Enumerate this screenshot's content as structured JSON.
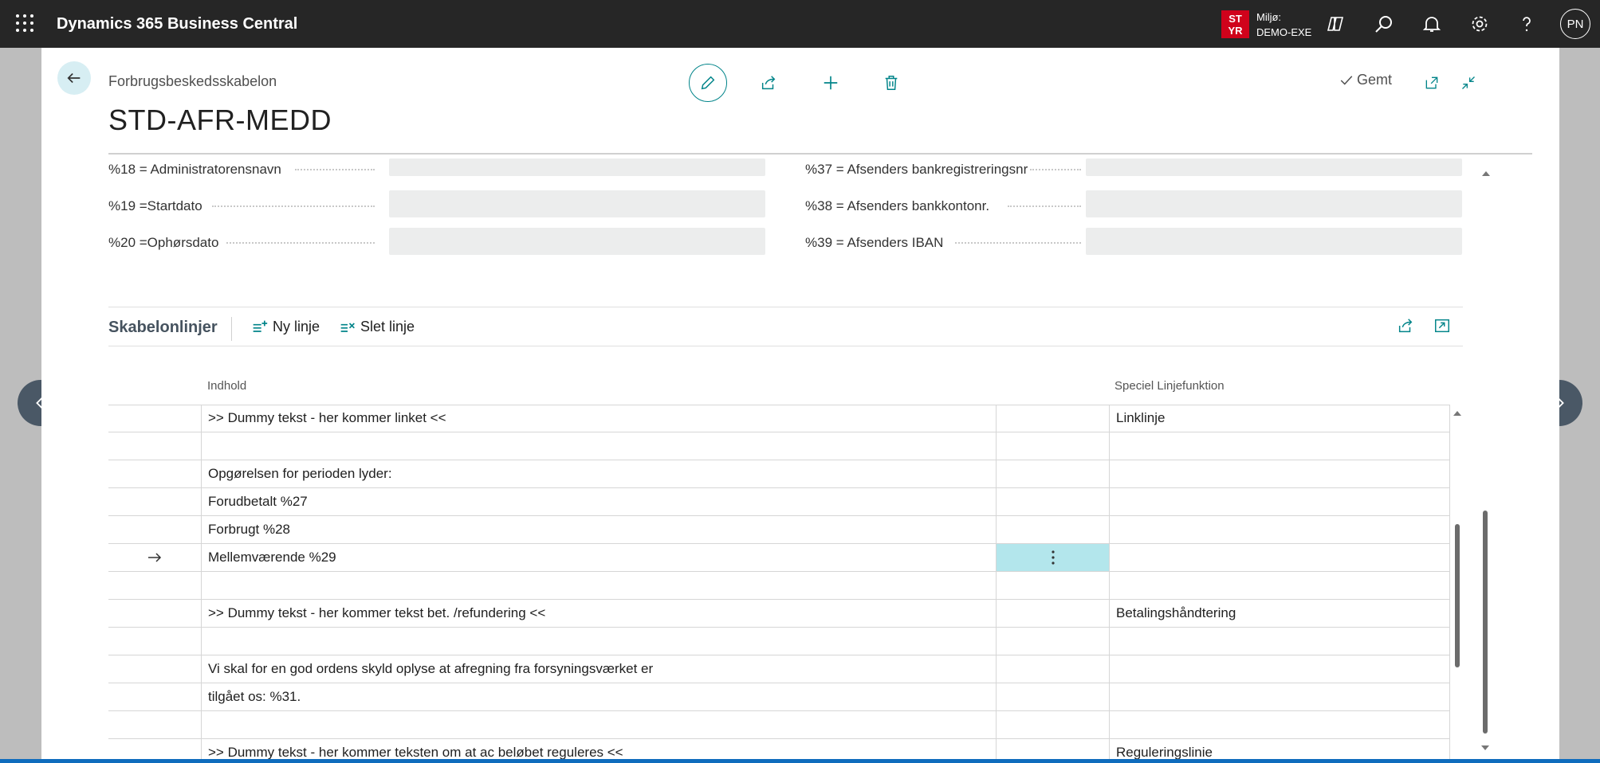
{
  "app": {
    "title": "Dynamics 365 Business Central",
    "environment_badge_line1": "ST",
    "environment_badge_line2": "YR",
    "environment_label": "Miljø:",
    "environment_name": "DEMO-EXE",
    "user_initials": "PN"
  },
  "header": {
    "caption": "Forbrugsbeskedsskabelon",
    "record_title": "STD-AFR-MEDD",
    "saved_label": "Gemt"
  },
  "fields_left": [
    {
      "label": "%18 = Administratorensnavn",
      "value": ""
    },
    {
      "label": "%19 =Startdato",
      "value": ""
    },
    {
      "label": "%20 =Ophørsdato",
      "value": ""
    }
  ],
  "fields_right": [
    {
      "label": "%37 = Afsenders bankregistreringsnr",
      "value": ""
    },
    {
      "label": "%38 = Afsenders bankkontonr.",
      "value": ""
    },
    {
      "label": "%39 = Afsenders IBAN",
      "value": ""
    }
  ],
  "part": {
    "title": "Skabelonlinjer",
    "new_line": "Ny linje",
    "delete_line": "Slet linje",
    "columns": {
      "content": "Indhold",
      "special": "Speciel Linjefunktion"
    },
    "rows": [
      {
        "content": ">> Dummy tekst - her kommer linket <<",
        "special": "Linklinje"
      },
      {
        "content": "",
        "special": ""
      },
      {
        "content": "Opgørelsen for perioden lyder:",
        "special": ""
      },
      {
        "content": "Forudbetalt %27",
        "special": ""
      },
      {
        "content": "Forbrugt %28",
        "special": ""
      },
      {
        "content": "Mellemværende %29",
        "special": "",
        "current": true
      },
      {
        "content": "",
        "special": ""
      },
      {
        "content": ">> Dummy tekst - her kommer tekst bet. /refundering <<",
        "special": "Betalingshåndtering"
      },
      {
        "content": "",
        "special": ""
      },
      {
        "content": "Vi skal for en god ordens skyld oplyse at afregning fra forsyningsværket er",
        "special": ""
      },
      {
        "content": "tilgået os: %31.",
        "special": ""
      },
      {
        "content": "",
        "special": ""
      },
      {
        "content": ">> Dummy tekst - her kommer teksten om at ac beløbet reguleres <<",
        "special": "Reguleringslinie"
      }
    ]
  },
  "icons": {
    "waffle": "app-launcher-icon",
    "copilot": "copilot-icon",
    "search": "search-icon",
    "bell": "notification-icon",
    "gear": "settings-icon",
    "help": "help-icon",
    "back": "back-arrow-icon",
    "edit": "pencil-icon",
    "share": "share-icon",
    "add": "plus-icon",
    "delete": "trash-icon",
    "popout": "open-new-window-icon",
    "collapse": "collapse-icon",
    "row_arrow": "current-row-arrow-icon",
    "row_menu": "ellipsis-vertical-icon"
  },
  "colors": {
    "accent": "#008489",
    "topbar": "#262626",
    "badge": "#d0021b",
    "active_cell": "#b3e6ec"
  }
}
